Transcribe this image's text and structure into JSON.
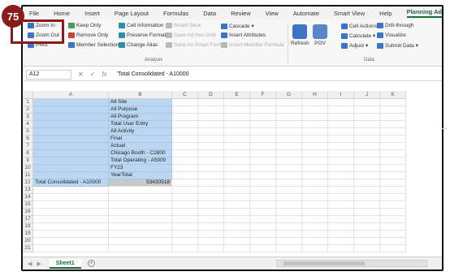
{
  "step_badge": "75",
  "tabs": [
    "File",
    "Home",
    "Insert",
    "Page Layout",
    "Formulas",
    "Data",
    "Review",
    "View",
    "Automate",
    "Smart View",
    "Help",
    "Planning Ad Hoc"
  ],
  "active_tab": "Planning Ad Hoc",
  "ribbon": {
    "zoom_in": "Zoom In",
    "zoom_out": "Zoom Out",
    "pivot": "Pivot",
    "keep_only": "Keep Only",
    "remove_only": "Remove Only",
    "member_selection": "Member Selection",
    "cell_information": "Cell Information",
    "preserve_format": "Preserve Format",
    "change_alias": "Change Alias",
    "smart_slice": "Smart Slice",
    "save_ad_hoc_grid": "Save Ad Hoc Grid",
    "save_as_smart_form": "Save As Smart Form",
    "cascade": "Cascade",
    "insert_attributes": "Insert Attributes",
    "insert_member_formula": "Insert Member Formula",
    "analysis_label": "Analysis",
    "refresh": "Refresh",
    "pov": "POV",
    "cell_actions": "Cell Actions",
    "calculate": "Calculate",
    "adjust": "Adjust",
    "drill_through": "Drill-through",
    "visualize": "Visualize",
    "submit_data": "Submit Data",
    "data_label": "Data"
  },
  "formula_bar": {
    "name_box": "A12",
    "fx": "fx",
    "formula": "'Total Consolidated - A10000"
  },
  "columns": [
    "A",
    "B",
    "C",
    "D",
    "E",
    "F",
    "G",
    "H",
    "I",
    "J",
    "K"
  ],
  "rows": [
    {
      "num": "1",
      "a": "",
      "b": "All Site"
    },
    {
      "num": "2",
      "a": "",
      "b": "All Purpose"
    },
    {
      "num": "3",
      "a": "",
      "b": "All Program"
    },
    {
      "num": "4",
      "a": "",
      "b": "Total User Entry"
    },
    {
      "num": "5",
      "a": "",
      "b": "All Activity"
    },
    {
      "num": "6",
      "a": "",
      "b": "Final"
    },
    {
      "num": "7",
      "a": "",
      "b": "Actual"
    },
    {
      "num": "8",
      "a": "",
      "b": "Chicago Booth - C2800"
    },
    {
      "num": "9",
      "a": "",
      "b": "Total Operating - A5000"
    },
    {
      "num": "10",
      "a": "",
      "b": "FY23"
    },
    {
      "num": "11",
      "a": "",
      "b": "YearTotal"
    },
    {
      "num": "12",
      "a": "Total Consolidated - A10000",
      "b": "53430518"
    },
    {
      "num": "13",
      "a": "",
      "b": ""
    },
    {
      "num": "14",
      "a": "",
      "b": ""
    },
    {
      "num": "15",
      "a": "",
      "b": ""
    },
    {
      "num": "16",
      "a": "",
      "b": ""
    },
    {
      "num": "17",
      "a": "",
      "b": ""
    },
    {
      "num": "18",
      "a": "",
      "b": ""
    },
    {
      "num": "19",
      "a": "",
      "b": ""
    },
    {
      "num": "20",
      "a": "",
      "b": ""
    },
    {
      "num": "21",
      "a": "",
      "b": ""
    }
  ],
  "sheet_tab": "Sheet1",
  "add_sheet": "+"
}
